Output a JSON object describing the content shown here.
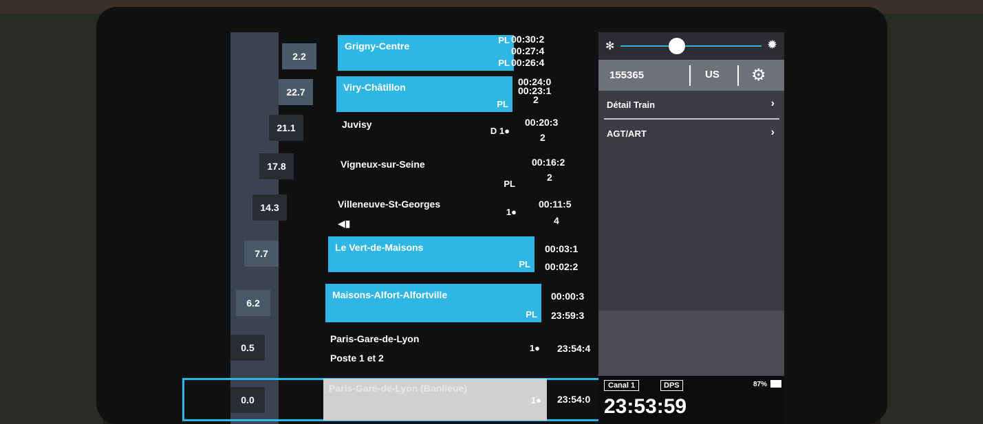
{
  "km_values": [
    "2.2",
    "22.7",
    "21.1",
    "17.8",
    "14.3",
    "7.7",
    "6.2",
    "0.5",
    "0.0"
  ],
  "stations": [
    {
      "name": "Grigny-Centre",
      "sub": "",
      "tag": "PL",
      "tag2": "PL",
      "cls": "",
      "highlight": true
    },
    {
      "name": "Viry-Châtillon",
      "sub": "",
      "tag": "PL",
      "tag2": "",
      "cls": "",
      "highlight": true
    },
    {
      "name": "Juvisy",
      "sub": "",
      "tag": "",
      "tag2": "",
      "cls": "D 1●",
      "highlight": false
    },
    {
      "name": "Vigneux-sur-Seine",
      "sub": "",
      "tag": "PL",
      "tag2": "",
      "cls": "",
      "highlight": false
    },
    {
      "name": "Villeneuve-St-Georges",
      "sub": "",
      "tag": "",
      "tag2": "",
      "cls": "1●",
      "highlight": false
    },
    {
      "name": "Le Vert-de-Maisons",
      "sub": "",
      "tag": "PL",
      "tag2": "",
      "cls": "",
      "highlight": true
    },
    {
      "name": "Maisons-Alfort-Alfortville",
      "sub": "",
      "tag": "PL",
      "tag2": "",
      "cls": "",
      "highlight": true
    },
    {
      "name": "Paris-Gare-de-Lyon",
      "sub": "Poste 1 et 2",
      "tag": "",
      "tag2": "",
      "cls": "1●",
      "highlight": false
    }
  ],
  "selected_station": {
    "name": "Paris-Gare-de-Lyon (Banlieue)",
    "cls": "1●",
    "time": "23:54:0"
  },
  "times": [
    [
      "00:30:2",
      "00:27:4",
      "00:26:4"
    ],
    [
      "00:24:0",
      "00:23:1",
      "2"
    ],
    [
      "00:20:3",
      "2"
    ],
    [
      "00:16:2",
      "2"
    ],
    [
      "00:11:5",
      "4"
    ],
    [
      "00:03:1",
      "00:02:2"
    ],
    [
      "00:00:3",
      "23:59:3"
    ],
    [
      "23:54:4"
    ]
  ],
  "panel": {
    "train_number": "155365",
    "mode": "US",
    "menu": [
      {
        "label": "Détail Train"
      },
      {
        "label": "AGT/ART"
      }
    ],
    "status": {
      "canal": "Canal 1",
      "dps": "DPS",
      "battery": "87%",
      "clock": "23:53:59"
    },
    "brightness_level": 0.38
  },
  "colors": {
    "highlight": "#2fb6e3",
    "panel": "#3b3d40"
  }
}
